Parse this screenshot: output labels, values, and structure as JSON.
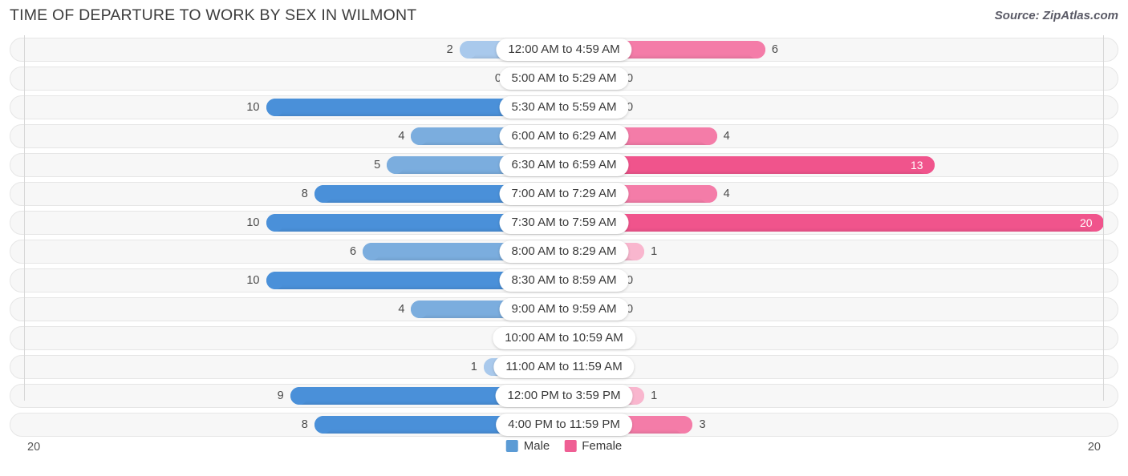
{
  "header": {
    "title": "TIME OF DEPARTURE TO WORK BY SEX IN WILMONT",
    "source": "Source: ZipAtlas.com"
  },
  "legend": {
    "items": [
      {
        "label": "Male",
        "color": "#5b9bd5"
      },
      {
        "label": "Female",
        "color": "#ef5f94"
      }
    ]
  },
  "axis": {
    "left_end": "20",
    "right_end": "20"
  },
  "colors": {
    "male_strong": "#4a90d9",
    "male_mid": "#7badde",
    "male_light": "#a9c9ec",
    "female_strong": "#f0548c",
    "female_mid": "#f47ca8",
    "female_light": "#f9b6ce",
    "track_bg": "#f7f7f7",
    "track_border": "#e6e6e6"
  },
  "chart_data": {
    "type": "bar",
    "subtype": "diverging-bidirectional",
    "title": "TIME OF DEPARTURE TO WORK BY SEX IN WILMONT",
    "xlabel": "",
    "ylabel": "",
    "xlim": [
      20,
      0,
      20
    ],
    "axis_max": 20,
    "grid": false,
    "legend_position": "bottom-center",
    "categories": [
      "12:00 AM to 4:59 AM",
      "5:00 AM to 5:29 AM",
      "5:30 AM to 5:59 AM",
      "6:00 AM to 6:29 AM",
      "6:30 AM to 6:59 AM",
      "7:00 AM to 7:29 AM",
      "7:30 AM to 7:59 AM",
      "8:00 AM to 8:29 AM",
      "8:30 AM to 8:59 AM",
      "9:00 AM to 9:59 AM",
      "10:00 AM to 10:59 AM",
      "11:00 AM to 11:59 AM",
      "12:00 PM to 3:59 PM",
      "4:00 PM to 11:59 PM"
    ],
    "series": [
      {
        "name": "Male",
        "direction": "left",
        "values": [
          2,
          0,
          10,
          4,
          5,
          8,
          10,
          6,
          10,
          4,
          0,
          1,
          9,
          8
        ]
      },
      {
        "name": "Female",
        "direction": "right",
        "values": [
          6,
          0,
          0,
          4,
          13,
          4,
          20,
          1,
          0,
          0,
          0,
          0,
          1,
          3
        ]
      }
    ]
  }
}
